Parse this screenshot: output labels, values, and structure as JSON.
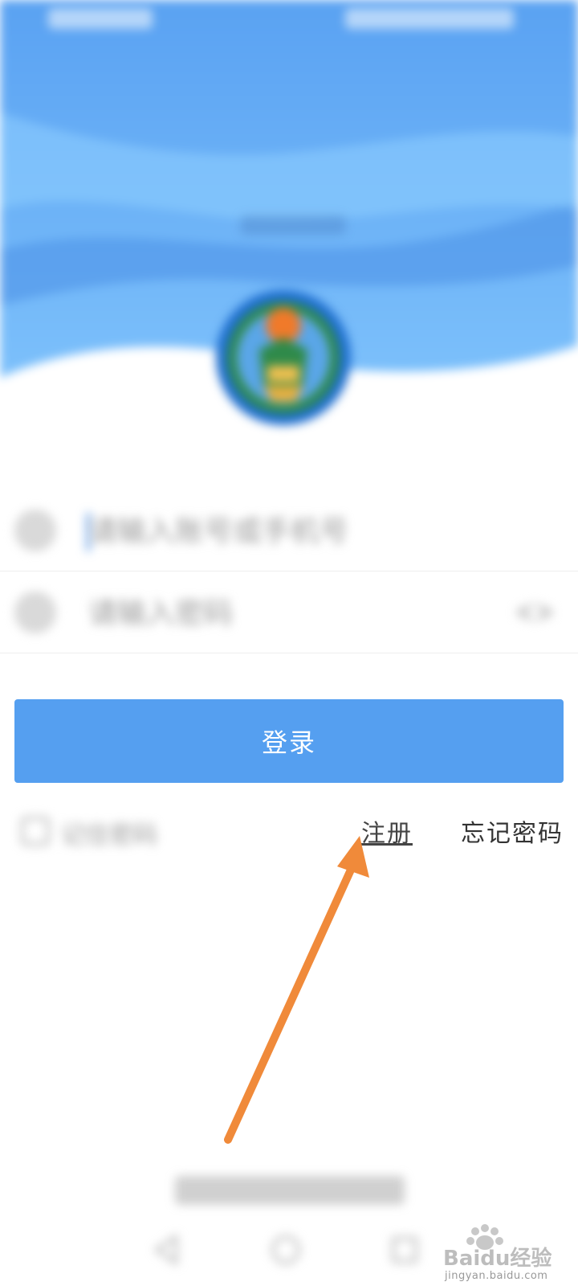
{
  "login": {
    "account_placeholder": "请输入账号或手机号",
    "password_placeholder": "请输入密码",
    "login_button": "登录",
    "remember_password": "记住密码",
    "register": "注册",
    "forgot_password": "忘记密码"
  },
  "watermark": {
    "text": "Baidu经验",
    "url": "jingyan.baidu.com"
  },
  "colors": {
    "primary": "#559ff0",
    "hero_top": "#5aa0f0",
    "arrow": "#f08a3a"
  }
}
